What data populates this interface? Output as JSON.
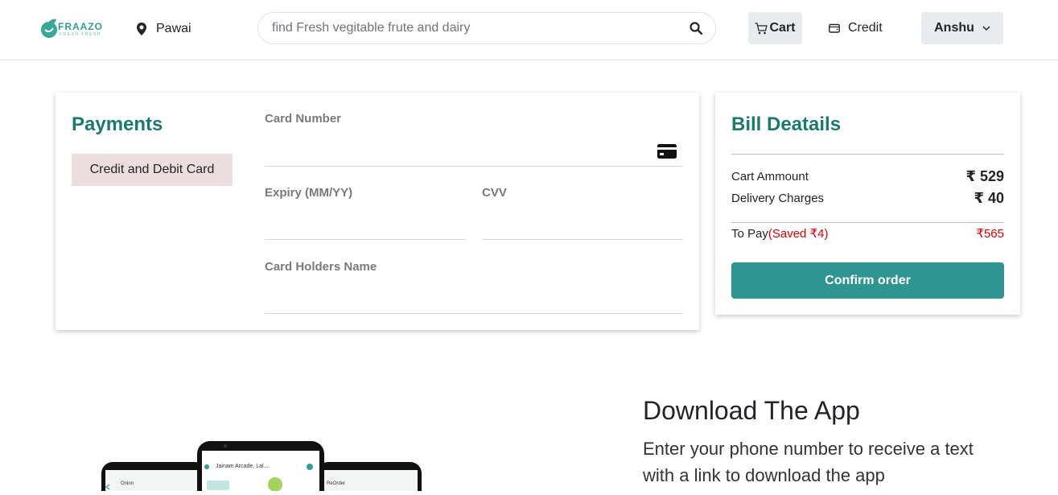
{
  "header": {
    "brand_name": "FRAAZO",
    "brand_tagline": "FRESH FRESH",
    "location": "Pawai",
    "search_placeholder": "find Fresh vegitable frute and dairy",
    "cart_label": "Cart",
    "credit_label": "Credit",
    "user_name": "Anshu"
  },
  "payments": {
    "title": "Payments",
    "method": "Credit and Debit Card",
    "card_number_label": "Card Number",
    "expiry_label": "Expiry (MM/YY)",
    "cvv_label": "CVV",
    "holder_label": "Card Holders Name"
  },
  "bill": {
    "title": "Bill Deatails",
    "cart_amount_label": "Cart Ammount",
    "cart_amount_value": "₹ 529",
    "delivery_label": "Delivery Charges",
    "delivery_value": "₹ 40",
    "to_pay_label": "To Pay",
    "saved_text": "(Saved ₹4)",
    "to_pay_value": "₹565",
    "confirm_label": "Confirm order"
  },
  "download": {
    "title": "Download The App",
    "text": "Enter your phone number to receive a text with a link to download the app",
    "phone_left_text": "Onion",
    "phone_center_text": "Jainam Arcade, Lal...",
    "phone_right_text": "ReOrder"
  },
  "colors": {
    "accent": "#1b7a6e",
    "button": "#2f9590",
    "highlight": "#ecdede",
    "saved": "#e00000"
  }
}
